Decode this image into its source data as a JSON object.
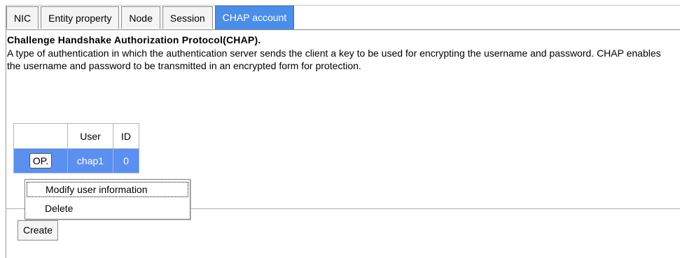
{
  "tabs": [
    "NIC",
    "Entity property",
    "Node",
    "Session",
    "CHAP account"
  ],
  "active_tab": "CHAP account",
  "heading": "Challenge Handshake Authorization Protocol(CHAP).",
  "description": "A type of authentication in which the authentication server sends the client a key to be used for encrypting the username and password. CHAP enables the username and password to be transmitted in an encrypted form for protection.",
  "table": {
    "columns": [
      "",
      "User",
      "ID"
    ],
    "rows": [
      {
        "op_label": "OP.",
        "user": "chap1",
        "id": "0"
      }
    ]
  },
  "context_menu": {
    "items": [
      "Modify user information",
      "Delete"
    ]
  },
  "create_label": "Create",
  "colors": {
    "accent": "#4b8ee8",
    "row_selected": "#5b8ff0"
  }
}
